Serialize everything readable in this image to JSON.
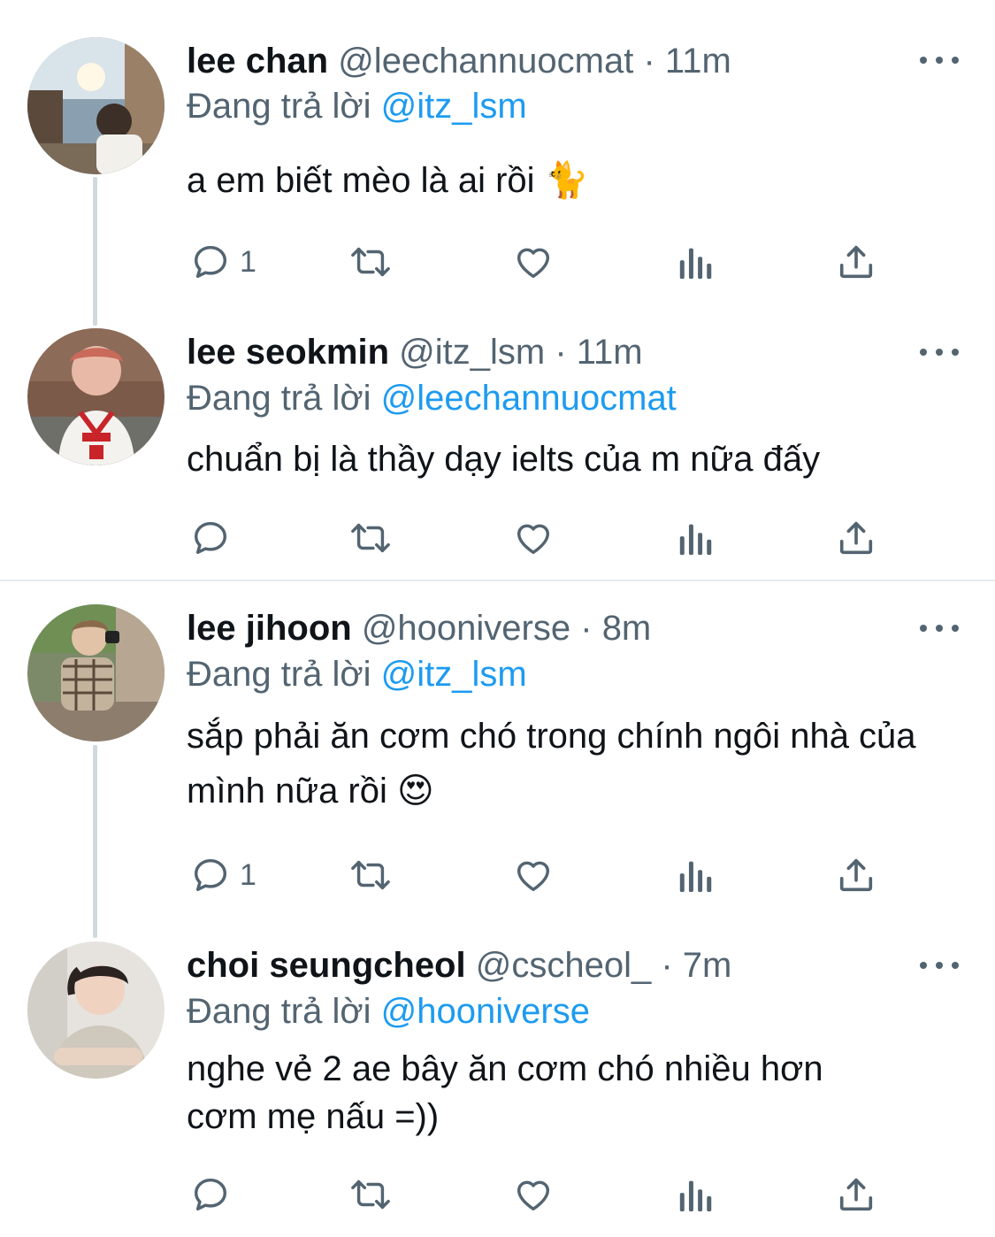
{
  "tweets": [
    {
      "name": "lee chan",
      "handle": "@leechannuocmat",
      "time": "11m",
      "dot": "·",
      "reply_prefix": "Đang trả lời ",
      "reply_to": "@itz_lsm",
      "text": "a em biết mèo là ai rồi 🐈",
      "reply_count": "1"
    },
    {
      "name": "lee seokmin",
      "handle": "@itz_lsm",
      "time": "11m",
      "dot": "·",
      "reply_prefix": "Đang trả lời ",
      "reply_to": "@leechannuocmat",
      "text": "chuẩn bị là thầy dạy ielts của m nữa đấy",
      "reply_count": ""
    },
    {
      "name": "lee jihoon",
      "handle": "@hooniverse",
      "time": "8m",
      "dot": "·",
      "reply_prefix": "Đang trả lời ",
      "reply_to": "@itz_lsm",
      "text": "sắp phải ăn cơm chó trong chính ngôi nhà của mình nữa rồi 😍",
      "reply_count": "1"
    },
    {
      "name": "choi seungcheol",
      "handle": "@cscheol_",
      "time": "7m",
      "dot": "·",
      "reply_prefix": "Đang trả lời ",
      "reply_to": "@hooniverse",
      "text": "nghe vẻ 2 ae bây ăn cơm chó nhiều hơn cơm mẹ nấu =))",
      "reply_count": ""
    }
  ],
  "icons": {
    "reply": "reply-icon",
    "retweet": "retweet-icon",
    "like": "heart-icon",
    "views": "analytics-icon",
    "share": "share-icon",
    "more": "more-icon"
  },
  "colors": {
    "text": "#0f1419",
    "secondary": "#536471",
    "link": "#1d9bf0",
    "thread_line": "#cfd9de",
    "separator": "#e7ebee"
  }
}
